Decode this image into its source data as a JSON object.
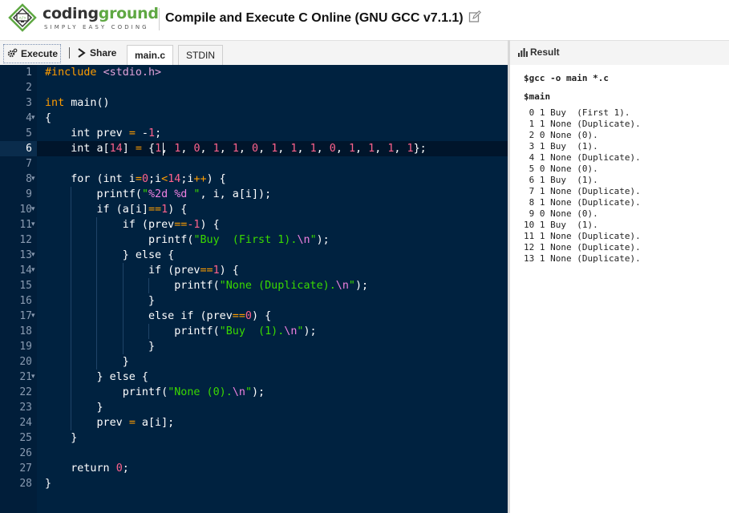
{
  "header": {
    "brand_part1": "coding",
    "brand_part2": "ground",
    "tagline": "SIMPLY EASY CODING",
    "title": "Compile and Execute C Online (GNU GCC v7.1.1)"
  },
  "toolbar": {
    "execute_label": "Execute",
    "share_label": "Share",
    "tabs": [
      {
        "label": "main.c",
        "active": true
      },
      {
        "label": "STDIN",
        "active": false
      }
    ]
  },
  "editor": {
    "active_line": 6,
    "line_numbers": [
      "1",
      "2",
      "3",
      "4",
      "5",
      "6",
      "7",
      "8",
      "9",
      "10",
      "11",
      "12",
      "13",
      "14",
      "15",
      "16",
      "17",
      "18",
      "19",
      "20",
      "21",
      "22",
      "23",
      "24",
      "25",
      "26",
      "27",
      "28"
    ],
    "fold_lines": [
      4,
      8,
      10,
      11,
      13,
      14,
      17,
      21
    ],
    "code": [
      "#include <stdio.h>",
      "",
      "int main()",
      "{",
      "    int prev = -1;",
      "    int a[14] = {1, 1, 0, 1, 1, 0, 1, 1, 1, 0, 1, 1, 1, 1};",
      "",
      "    for (int i=0;i<14;i++) {",
      "        printf(\"%2d %d \", i, a[i]);",
      "        if (a[i]==1) {",
      "            if (prev==-1) {",
      "                printf(\"Buy  (First 1).\\n\");",
      "            } else {",
      "                if (prev==1) {",
      "                    printf(\"None (Duplicate).\\n\");",
      "                }",
      "                else if (prev==0) {",
      "                    printf(\"Buy  (1).\\n\");",
      "                }",
      "            }",
      "        } else {",
      "            printf(\"None (0).\\n\");",
      "        }",
      "        prev = a[i];",
      "    }",
      "",
      "    return 0;",
      "}"
    ]
  },
  "result": {
    "title": "Result",
    "command1": "$gcc -o main *.c",
    "command2": "$main",
    "output": [
      " 0 1 Buy  (First 1).",
      " 1 1 None (Duplicate).",
      " 2 0 None (0).",
      " 3 1 Buy  (1).",
      " 4 1 None (Duplicate).",
      " 5 0 None (0).",
      " 6 1 Buy  (1).",
      " 7 1 None (Duplicate).",
      " 8 1 None (Duplicate).",
      " 9 0 None (0).",
      "10 1 Buy  (1).",
      "11 1 None (Duplicate).",
      "12 1 None (Duplicate).",
      "13 1 None (Duplicate)."
    ]
  },
  "colors": {
    "editor_bg": "#002240",
    "keyword": "#ff9d00",
    "number": "#ff628c",
    "string": "#3ad900",
    "brand_green": "#5fa843"
  },
  "icons": {
    "logo": "codingground-monitor-logo",
    "edit": "edit-icon",
    "execute": "gear-icon",
    "share": "chevron-right-icon",
    "result": "bar-chart-icon"
  }
}
